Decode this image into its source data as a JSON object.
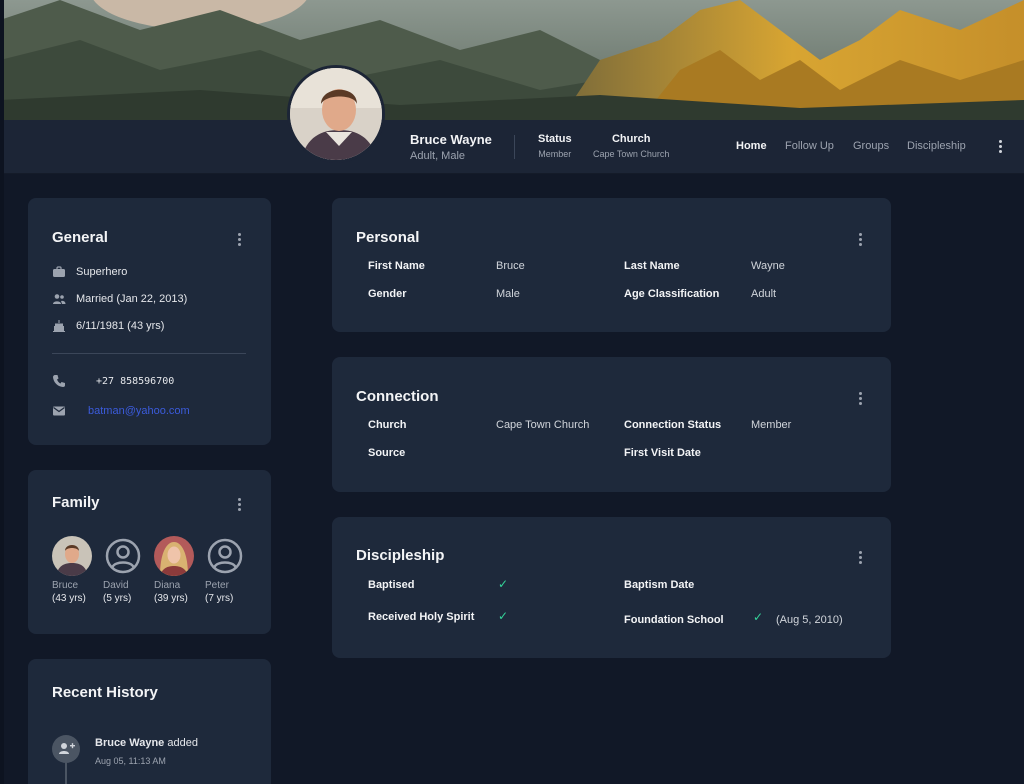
{
  "profile": {
    "name": "Bruce Wayne",
    "subtitle": "Adult, Male",
    "status_label": "Status",
    "status_value": "Member",
    "church_label": "Church",
    "church_value": "Cape Town Church"
  },
  "nav": {
    "home": "Home",
    "follow_up": "Follow Up",
    "groups": "Groups",
    "discipleship": "Discipleship"
  },
  "general": {
    "title": "General",
    "occupation": "Superhero",
    "marital": "Married (Jan 22, 2013)",
    "birthday": "6/11/1981 (43 yrs)",
    "phone": "+27 858596700",
    "email": "batman@yahoo.com"
  },
  "family": {
    "title": "Family",
    "members": [
      {
        "name": "Bruce",
        "age": "(43 yrs)"
      },
      {
        "name": "David",
        "age": "(5 yrs)"
      },
      {
        "name": "Diana",
        "age": "(39 yrs)"
      },
      {
        "name": "Peter",
        "age": "(7 yrs)"
      }
    ]
  },
  "history": {
    "title": "Recent History",
    "items": [
      {
        "actor": "Bruce Wayne",
        "action": "added",
        "time": "Aug 05, 11:13 AM"
      }
    ]
  },
  "personal": {
    "title": "Personal",
    "first_name_label": "First Name",
    "first_name": "Bruce",
    "last_name_label": "Last Name",
    "last_name": "Wayne",
    "gender_label": "Gender",
    "gender": "Male",
    "age_class_label": "Age Classification",
    "age_class": "Adult"
  },
  "connection": {
    "title": "Connection",
    "church_label": "Church",
    "church": "Cape Town Church",
    "conn_status_label": "Connection Status",
    "conn_status": "Member",
    "source_label": "Source",
    "first_visit_label": "First Visit Date"
  },
  "discipleship": {
    "title": "Discipleship",
    "baptised_label": "Baptised",
    "baptism_date_label": "Baptism Date",
    "holy_spirit_label": "Received Holy Spirit",
    "foundation_label": "Foundation School",
    "foundation_date": "(Aug 5, 2010)",
    "check": "✓"
  },
  "colors": {
    "background": "#111827",
    "card": "#1e293b",
    "accent_link": "#3b5bdb",
    "check": "#34d399"
  }
}
